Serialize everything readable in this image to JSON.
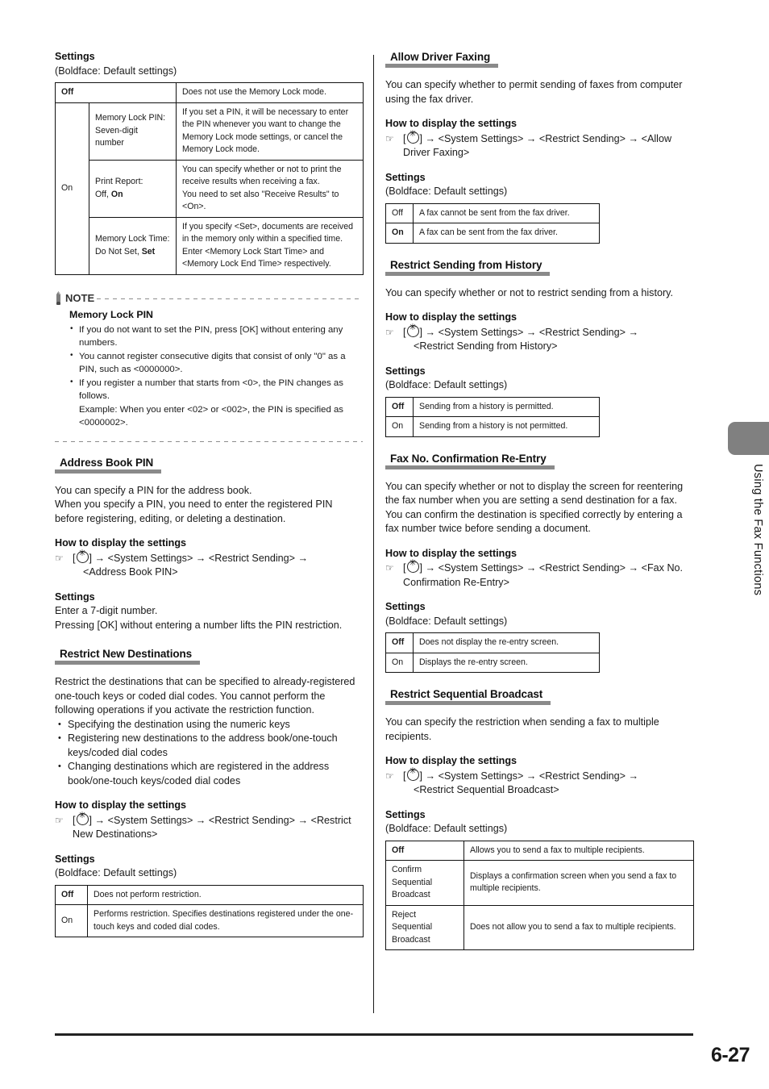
{
  "page": {
    "number": "6-27",
    "side_tab_label": "Using the Fax Functions"
  },
  "common": {
    "settings_label": "Settings",
    "boldface_note": "(Boldface: Default settings)",
    "how_to_display": "How to display the settings",
    "arrow": "→",
    "hand_icon": "☞",
    "bracket_open": "[",
    "bracket_close": "]"
  },
  "left_column": {
    "memory_lock": {
      "settings_label": "Settings",
      "boldface_note": "(Boldface: Default settings)",
      "table": {
        "off_label": "Off",
        "off_desc": "Does not use the Memory Lock mode.",
        "on_label": "On",
        "rows": [
          {
            "name": "Memory Lock PIN:\nSeven-digit\nnumber",
            "desc": "If you set a PIN, it will be necessary to enter the PIN whenever you want to change the Memory Lock mode settings, or cancel the Memory Lock mode."
          },
          {
            "name": "Print Report:\nOff, On",
            "desc": "You can specify whether or not to print the receive results when receiving a fax.\nYou need to set also \"Receive Results\" to <On>."
          },
          {
            "name": "Memory Lock Time:\nDo Not Set, Set",
            "desc": "If you specify <Set>, documents are received in the memory only within a specified time.\nEnter <Memory Lock Start Time> and <Memory Lock End Time> respectively."
          }
        ]
      }
    },
    "note": {
      "label": "NOTE",
      "title": "Memory Lock PIN",
      "items": [
        "If you do not want to set the PIN, press [OK] without entering any numbers.",
        "You cannot register consecutive digits that consist of only \"0\" as a PIN, such as <0000000>.",
        "If you register a number that starts from <0>, the PIN changes as follows.\nExample: When you enter <02> or <002>, the PIN is specified as <0000002>."
      ]
    },
    "address_book_pin": {
      "heading": "Address Book PIN",
      "intro": "You can specify a PIN for the address book.\nWhen you specify a PIN, you need to enter the registered PIN before registering, editing, or deleting a destination.",
      "how_to_display": "How to display the settings",
      "path_part1": "<System Settings>",
      "path_part2": "<Restrict Sending>",
      "path_part3": "<Address Book PIN>",
      "settings_label": "Settings",
      "settings_text": "Enter a 7-digit number.\nPressing [OK] without entering a number lifts the PIN restriction."
    },
    "restrict_new_destinations": {
      "heading": "Restrict New Destinations",
      "intro": "Restrict the destinations that can be specified to already-registered one-touch keys or coded dial codes. You cannot perform the following operations if you activate the restriction function.",
      "bullets": [
        "Specifying the destination using the numeric keys",
        "Registering new destinations to the address book/one-touch keys/coded dial codes",
        "Changing destinations which are registered in the address book/one-touch keys/coded dial codes"
      ],
      "how_to_display": "How to display the settings",
      "path_part1": "<System Settings>",
      "path_part2": "<Restrict Sending>",
      "path_part3": "<Restrict New Destinations>",
      "settings_label": "Settings",
      "boldface_note": "(Boldface: Default settings)",
      "table": [
        {
          "key": "Off",
          "bold": true,
          "desc": "Does not perform restriction."
        },
        {
          "key": "On",
          "bold": false,
          "desc": "Performs restriction. Specifies destinations registered under the one-touch keys and coded dial codes."
        }
      ]
    }
  },
  "right_column": {
    "allow_driver_faxing": {
      "heading": "Allow Driver Faxing",
      "intro": "You can specify whether to permit sending of faxes from computer using the fax driver.",
      "how_to_display": "How to display the settings",
      "path_part1": "<System Settings>",
      "path_part2": "<Restrict Sending>",
      "path_part3": "<Allow Driver Faxing>",
      "settings_label": "Settings",
      "boldface_note": "(Boldface: Default settings)",
      "table": [
        {
          "key": "Off",
          "bold": false,
          "desc": "A fax cannot be sent from the fax driver."
        },
        {
          "key": "On",
          "bold": true,
          "desc": "A fax can be sent from the fax driver."
        }
      ]
    },
    "restrict_sending_history": {
      "heading": "Restrict Sending from History",
      "intro": "You can specify whether or not to restrict sending from a history.",
      "how_to_display": "How to display the settings",
      "path_part1": "<System Settings>",
      "path_part2": "<Restrict Sending>",
      "path_part3": "<Restrict Sending from History>",
      "settings_label": "Settings",
      "boldface_note": "(Boldface: Default settings)",
      "table": [
        {
          "key": "Off",
          "bold": true,
          "desc": "Sending from a history is permitted."
        },
        {
          "key": "On",
          "bold": false,
          "desc": "Sending from a history is not permitted."
        }
      ]
    },
    "fax_no_confirmation": {
      "heading": "Fax No. Confirmation Re-Entry",
      "intro": "You can specify whether or not to display the screen for reentering the fax number when you are setting a send destination for a fax. You can confirm the destination is specified correctly by entering a fax number twice before sending a document.",
      "how_to_display": "How to display the settings",
      "path_part1": "<System Settings>",
      "path_part2": "<Restrict Sending>",
      "path_part3": "<Fax No. Confirmation Re-Entry>",
      "settings_label": "Settings",
      "boldface_note": "(Boldface: Default settings)",
      "table": [
        {
          "key": "Off",
          "bold": true,
          "desc": "Does not display the re-entry screen."
        },
        {
          "key": "On",
          "bold": false,
          "desc": "Displays the re-entry screen."
        }
      ]
    },
    "restrict_sequential_broadcast": {
      "heading": "Restrict Sequential Broadcast",
      "intro": "You can specify the restriction when sending a fax to multiple recipients.",
      "how_to_display": "How to display the settings",
      "path_part1": "<System Settings>",
      "path_part2": "<Restrict Sending>",
      "path_part3": "<Restrict Sequential Broadcast>",
      "settings_label": "Settings",
      "boldface_note": "(Boldface: Default settings)",
      "table": [
        {
          "key": "Off",
          "bold": true,
          "desc": "Allows you to send a fax to multiple recipients."
        },
        {
          "key": "Confirm Sequential Broadcast",
          "bold": false,
          "desc": "Displays a confirmation screen when you send a fax to multiple recipients."
        },
        {
          "key": "Reject Sequential Broadcast",
          "bold": false,
          "desc": "Does not allow you to send a fax to multiple recipients."
        }
      ]
    }
  }
}
